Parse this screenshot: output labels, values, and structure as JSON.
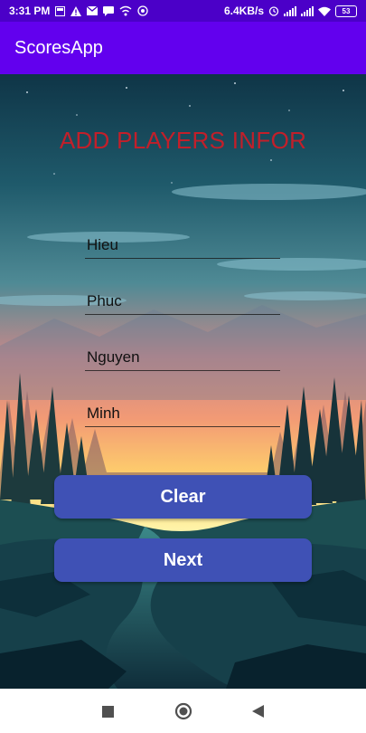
{
  "status_bar": {
    "time": "3:31 PM",
    "speed": "6.4KB/s",
    "battery": "53",
    "left_icons": [
      "photo-icon",
      "warning-icon",
      "mail-icon",
      "message-icon",
      "wifi-call-icon",
      "whatsapp-icon"
    ],
    "right_icons": [
      "alarm-icon",
      "signal-icon",
      "signal-icon",
      "wifi-icon",
      "battery-icon"
    ]
  },
  "app_bar": {
    "title": "ScoresApp"
  },
  "main": {
    "heading": "ADD PLAYERS INFOR",
    "players": [
      {
        "value": "Hieu"
      },
      {
        "value": "Phuc"
      },
      {
        "value": "Nguyen"
      },
      {
        "value": "Minh"
      }
    ],
    "clear_label": "Clear",
    "next_label": "Next"
  },
  "colors": {
    "status_bar": "#4b00c8",
    "app_bar": "#6200ee",
    "heading": "#c21f2a",
    "button": "#3f51b5"
  }
}
